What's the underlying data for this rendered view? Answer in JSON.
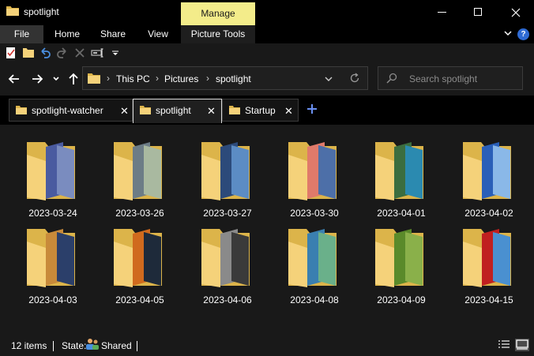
{
  "window": {
    "title": "spotlight",
    "contextual_tab": "Manage"
  },
  "ribbon": {
    "tabs": [
      "File",
      "Home",
      "Share",
      "View",
      "Picture Tools"
    ],
    "help_label": "?"
  },
  "address": {
    "crumbs": [
      "This PC",
      "Pictures",
      "spotlight"
    ]
  },
  "search": {
    "placeholder": "Search spotlight"
  },
  "folder_tabs": [
    {
      "label": "spotlight-watcher",
      "active": false
    },
    {
      "label": "spotlight",
      "active": true
    },
    {
      "label": "Startup",
      "active": false
    }
  ],
  "folders": [
    {
      "name": "2023-03-24",
      "thumbs": [
        "#4a5ba0",
        "#7a8cbf"
      ]
    },
    {
      "name": "2023-03-26",
      "thumbs": [
        "#6c7c86",
        "#a9b9a0"
      ]
    },
    {
      "name": "2023-03-27",
      "thumbs": [
        "#2c4a7a",
        "#5c8cc4"
      ]
    },
    {
      "name": "2023-03-30",
      "thumbs": [
        "#e07a6a",
        "#4d6fa8"
      ]
    },
    {
      "name": "2023-04-01",
      "thumbs": [
        "#3b6d3f",
        "#2b8ab0"
      ]
    },
    {
      "name": "2023-04-02",
      "thumbs": [
        "#2a5fb8",
        "#8ab8e8"
      ]
    },
    {
      "name": "2023-04-03",
      "thumbs": [
        "#c88a3a",
        "#2b3f6a"
      ]
    },
    {
      "name": "2023-04-05",
      "thumbs": [
        "#d06a1e",
        "#1e2a3a"
      ]
    },
    {
      "name": "2023-04-06",
      "thumbs": [
        "#8a8a8a",
        "#3a3a3a"
      ]
    },
    {
      "name": "2023-04-08",
      "thumbs": [
        "#3a7fb0",
        "#6ab08a"
      ]
    },
    {
      "name": "2023-04-09",
      "thumbs": [
        "#5a8a2a",
        "#8ab04a"
      ]
    },
    {
      "name": "2023-04-15",
      "thumbs": [
        "#c02020",
        "#4a90d0"
      ]
    }
  ],
  "status": {
    "item_count": "12 items",
    "state_label": "State:",
    "state_value": "Shared"
  },
  "colors": {
    "folder_back": "#dcb44a",
    "folder_front": "#f5d27a",
    "manage_bg": "#f3ec8a"
  }
}
